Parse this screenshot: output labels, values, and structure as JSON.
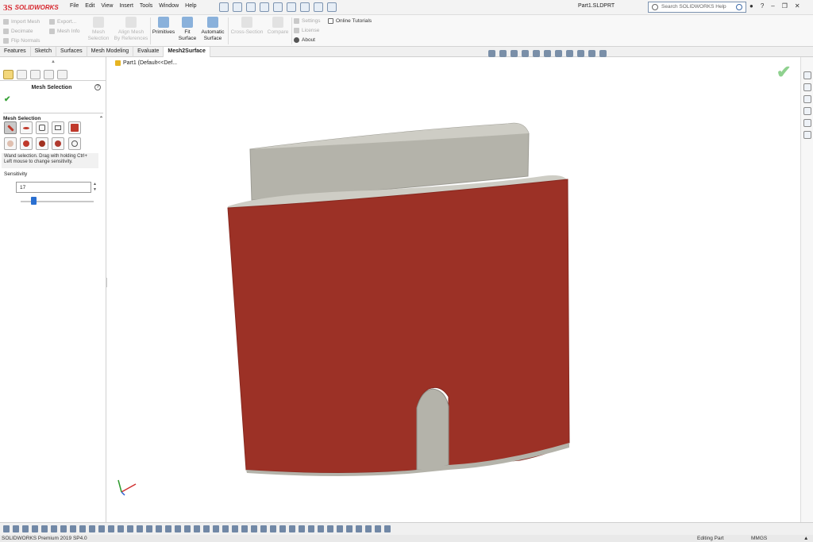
{
  "app": {
    "logo_text": "SOLIDWORKS",
    "document_title": "Part1.SLDPRT",
    "menu": [
      "File",
      "Edit",
      "View",
      "Insert",
      "Tools",
      "Window",
      "Help"
    ],
    "search_placeholder": "Search SOLIDWORKS Help"
  },
  "ribbon": {
    "left_group": {
      "import_mesh": "Import Mesh",
      "decimate": "Decimate",
      "flip_normals": "Flip Normals",
      "export": "Export...",
      "mesh_info": "Mesh Info"
    },
    "buttons": {
      "mesh_selection_1": "Mesh",
      "mesh_selection_2": "Selection",
      "align_mesh_1": "Align Mesh",
      "align_mesh_2": "By References",
      "primitives": "Primitives",
      "fit_surface_1": "Fit",
      "fit_surface_2": "Surface",
      "automatic_surface_1": "Automatic",
      "automatic_surface_2": "Surface",
      "cross_section": "Cross-Section",
      "compare": "Compare"
    },
    "right_group": {
      "settings": "Settings",
      "license": "License",
      "about": "About",
      "online_tutorials": "Online Tutorials"
    }
  },
  "tabs": [
    "Features",
    "Sketch",
    "Surfaces",
    "Mesh Modeling",
    "Evaluate",
    "Mesh2Surface"
  ],
  "active_tab": "Mesh2Surface",
  "panel": {
    "title": "Mesh Selection",
    "section_title": "Mesh Selection",
    "tooltip": "Wand selection. Drag with holding Ctrl+ Left mouse to change sensitivity.",
    "sensitivity_label": "Sensitivity",
    "sensitivity_value": "17",
    "sensitivity_fraction": 0.17
  },
  "graphics": {
    "tree_label": "Part1  (Default<<Def...",
    "model_colors": {
      "selected": "#9c3126",
      "unselected": "#b4b3aa",
      "top": "#cecdc5"
    }
  },
  "status": {
    "left": "SOLIDWORKS Premium 2019 SP4.0",
    "mode": "Editing Part",
    "units": "MMGS"
  }
}
